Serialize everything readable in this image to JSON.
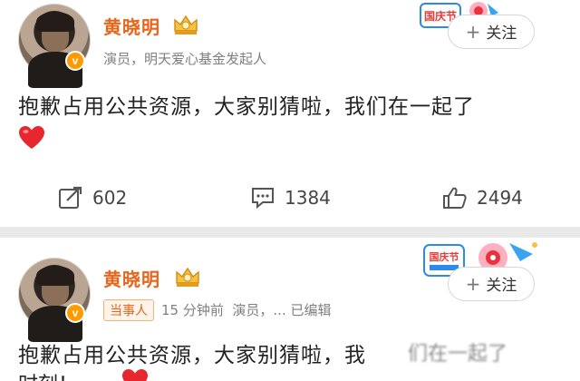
{
  "posts": [
    {
      "username": "黄晓明",
      "subtitle": "演员，明天爱心基金发起人",
      "follow_label": "关注",
      "content": "抱歉占用公共资源，大家别猜啦，我们在一起了",
      "emoji": "red-heart",
      "actions": {
        "repost_count": "602",
        "comment_count": "1384",
        "like_count": "2494"
      }
    },
    {
      "username": "黄晓明",
      "tag": "当事人",
      "time": "15 分钟前",
      "subtitle": "演员，... 已编辑",
      "follow_label": "关注",
      "content_visible": "抱歉占用公共资源，大家别猜啦，我",
      "content_blurred": "们在一起了",
      "content_line2": "时刻！"
    }
  ],
  "sticker_text": "国庆节",
  "colors": {
    "username": "#e8651b",
    "badge": "#ff9b00",
    "background": "#e9e9ea"
  }
}
